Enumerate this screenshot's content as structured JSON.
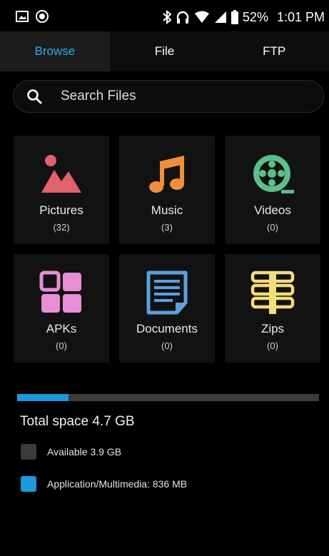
{
  "status_bar": {
    "icons_left": [
      "image-notification-icon",
      "fm-radio-icon"
    ],
    "icons_right": [
      "bluetooth-icon",
      "headphones-icon",
      "wifi-icon",
      "cell-signal-icon",
      "battery-icon"
    ],
    "battery": "52%",
    "time": "1:01 PM"
  },
  "tabs": [
    {
      "label": "Browse",
      "active": true
    },
    {
      "label": "File",
      "active": false
    },
    {
      "label": "FTP",
      "active": false
    }
  ],
  "search": {
    "placeholder": "Search Files",
    "icon": "search-icon"
  },
  "categories": [
    {
      "label": "Pictures",
      "count": "(32)",
      "icon": "pictures-icon",
      "color": "#e0626a"
    },
    {
      "label": "Music",
      "count": "(3)",
      "icon": "music-icon",
      "color": "#ef8f3c"
    },
    {
      "label": "Videos",
      "count": "(0)",
      "icon": "videos-icon",
      "color": "#5cbf8a"
    },
    {
      "label": "APKs",
      "count": "(0)",
      "icon": "apks-icon",
      "color": "#e88ed6"
    },
    {
      "label": "Documents",
      "count": "(0)",
      "icon": "documents-icon",
      "color": "#5aa0e0"
    },
    {
      "label": "Zips",
      "count": "(0)",
      "icon": "zips-icon",
      "color": "#f3de7c"
    }
  ],
  "storage": {
    "total_label": "Total space 4.7 GB",
    "used_fraction": 0.17,
    "fill_color": "#1e97dc",
    "legend": [
      {
        "label": "Available 3.9 GB",
        "color": "#3b3b3b"
      },
      {
        "label": "Application/Multimedia: 836 MB",
        "color": "#1e97dc"
      }
    ]
  }
}
